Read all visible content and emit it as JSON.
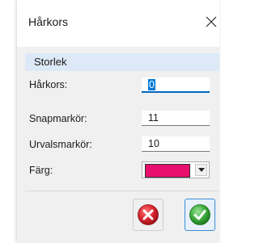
{
  "dialog": {
    "title": "Hårkors",
    "close_icon": "close-icon"
  },
  "group": {
    "title": "Storlek"
  },
  "fields": [
    {
      "label": "Hårkors:",
      "value": "0"
    },
    {
      "label": "Snapmarkör:",
      "value": "11"
    },
    {
      "label": "Urvalsmarkör:",
      "value": "10"
    }
  ],
  "color_field": {
    "label": "Färg:",
    "value_color": "#e8106e",
    "arrow_icon": "dropdown-arrow-icon"
  },
  "buttons": {
    "cancel_icon": "cancel-icon",
    "ok_icon": "ok-check-icon"
  },
  "colors": {
    "group_header": "#dde9f7",
    "focus_accent": "#0067c0",
    "cancel_red": "#d9262f",
    "ok_green": "#3cac3c"
  }
}
